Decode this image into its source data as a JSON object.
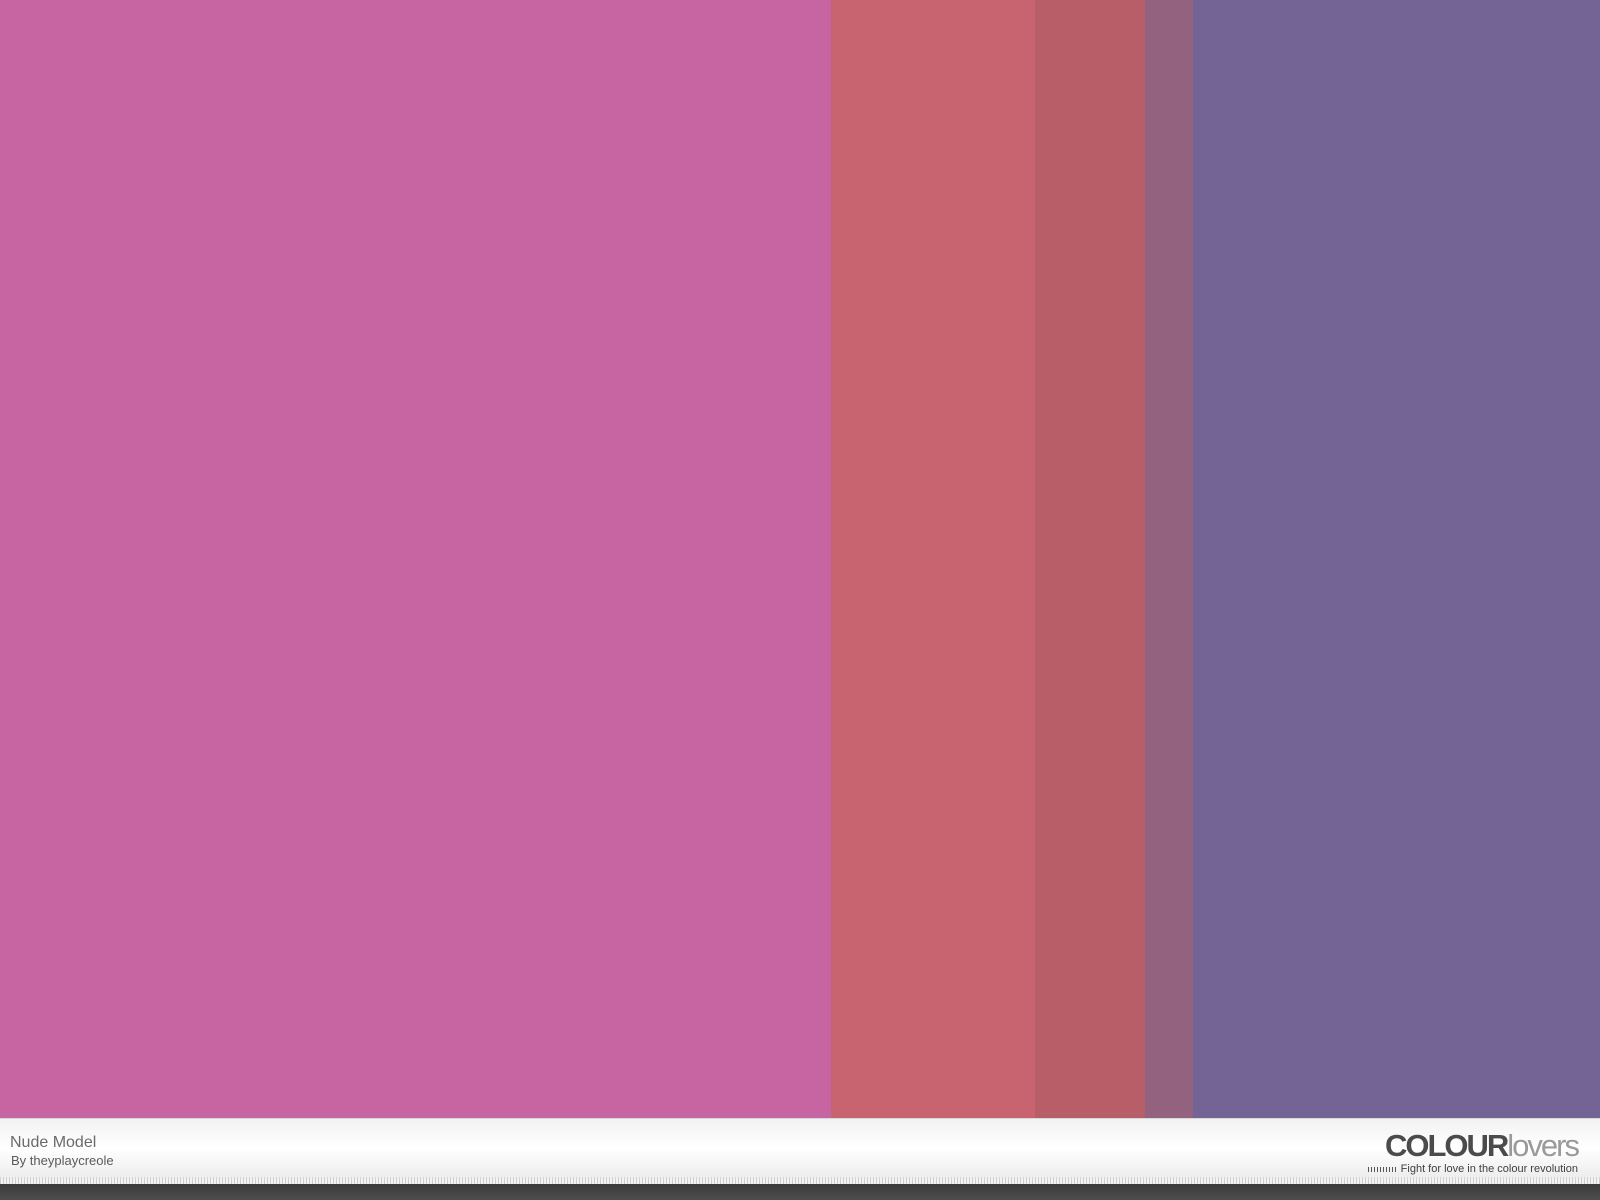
{
  "palette": {
    "title": "Nude Model",
    "author": "By theyplaycreole",
    "colors": [
      {
        "hex": "#C765A2",
        "share": 0.5194
      },
      {
        "hex": "#C7646F",
        "share": 0.1275
      },
      {
        "hex": "#B75E69",
        "share": 0.0687
      },
      {
        "hex": "#93627E",
        "share": 0.03
      },
      {
        "hex": "#746395",
        "share": 0.2544
      }
    ]
  },
  "branding": {
    "logo_strong": "COLOUR",
    "logo_light": "lovers",
    "tagline": "Fight for love in the colour revolution"
  }
}
